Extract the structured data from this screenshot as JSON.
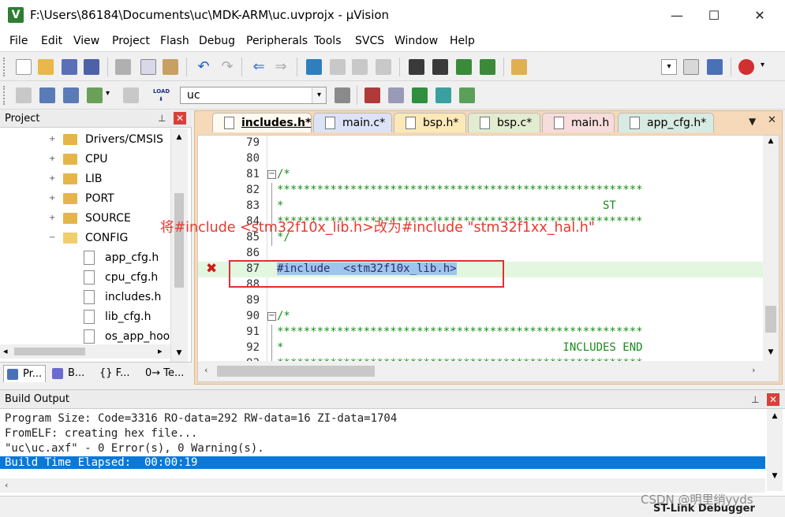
{
  "window": {
    "title": "F:\\Users\\86184\\Documents\\uc\\MDK-ARM\\uc.uvprojx - µVision",
    "minimize": "—",
    "maximize": "☐",
    "close": "✕"
  },
  "menu": [
    "File",
    "Edit",
    "View",
    "Project",
    "Flash",
    "Debug",
    "Peripherals",
    "Tools",
    "SVCS",
    "Window",
    "Help"
  ],
  "toolbar2": {
    "target": "uc",
    "load_label": "LOAD"
  },
  "project": {
    "title": "Project",
    "tree": [
      {
        "label": "Drivers/CMSIS",
        "type": "folder",
        "expander": "+"
      },
      {
        "label": "CPU",
        "type": "folder",
        "expander": "+"
      },
      {
        "label": "LIB",
        "type": "folder",
        "expander": "+"
      },
      {
        "label": "PORT",
        "type": "folder",
        "expander": "+"
      },
      {
        "label": "SOURCE",
        "type": "folder",
        "expander": "+"
      },
      {
        "label": "CONFIG",
        "type": "folder",
        "expander": "−"
      },
      {
        "label": "app_cfg.h",
        "type": "file"
      },
      {
        "label": "cpu_cfg.h",
        "type": "file"
      },
      {
        "label": "includes.h",
        "type": "file"
      },
      {
        "label": "lib_cfg.h",
        "type": "file"
      },
      {
        "label": "os_app_hook",
        "type": "file"
      }
    ],
    "bottom_tabs": [
      {
        "label": "Pr...",
        "icon": "project-icon"
      },
      {
        "label": "B...",
        "icon": "books-icon"
      },
      {
        "label": "{} F...",
        "icon": "functions-icon"
      },
      {
        "label": "0→ Te...",
        "icon": "templates-icon"
      }
    ]
  },
  "editor": {
    "tabs": [
      {
        "label": "includes.h*",
        "active": true,
        "color": "#fffaf0"
      },
      {
        "label": "main.c*",
        "active": false,
        "color": "#dde3f6"
      },
      {
        "label": "bsp.h*",
        "active": false,
        "color": "#fbe9b8"
      },
      {
        "label": "bsp.c*",
        "active": false,
        "color": "#e2ecd0"
      },
      {
        "label": "main.h",
        "active": false,
        "color": "#f7dcdc"
      },
      {
        "label": "app_cfg.h*",
        "active": false,
        "color": "#d8ebe2"
      }
    ],
    "lines": [
      {
        "num": "79",
        "code": ""
      },
      {
        "num": "80",
        "code": ""
      },
      {
        "num": "81",
        "code": "/*",
        "fold": "−"
      },
      {
        "num": "82",
        "code": "*******************************************************"
      },
      {
        "num": "83",
        "code": "*                                                ST"
      },
      {
        "num": "84",
        "code": "*******************************************************"
      },
      {
        "num": "85",
        "code": "*/"
      },
      {
        "num": "86",
        "code": ""
      },
      {
        "num": "87",
        "code": "#include  <stm32f10x_lib.h>",
        "highlight": true,
        "error": "✖"
      },
      {
        "num": "88",
        "code": ""
      },
      {
        "num": "89",
        "code": ""
      },
      {
        "num": "90",
        "code": "/*",
        "fold": "−"
      },
      {
        "num": "91",
        "code": "*******************************************************"
      },
      {
        "num": "92",
        "code": "*                                          INCLUDES END"
      },
      {
        "num": "93",
        "code": "*******************************************************"
      }
    ]
  },
  "annotation": {
    "text": "将#include <stm32f10x_lib.h>改为#include \"stm32f1xx_hal.h\""
  },
  "build": {
    "title": "Build Output",
    "lines": [
      "Program Size: Code=3316 RO-data=292 RW-data=16 ZI-data=1704",
      "FromELF: creating hex file...",
      "\"uc\\uc.axf\" - 0 Error(s), 0 Warning(s).",
      "Build Time Elapsed:  00:00:19"
    ]
  },
  "status": {
    "debugger": "ST-Link Debugger"
  },
  "watermark": "CSDN @明里绡yyds"
}
